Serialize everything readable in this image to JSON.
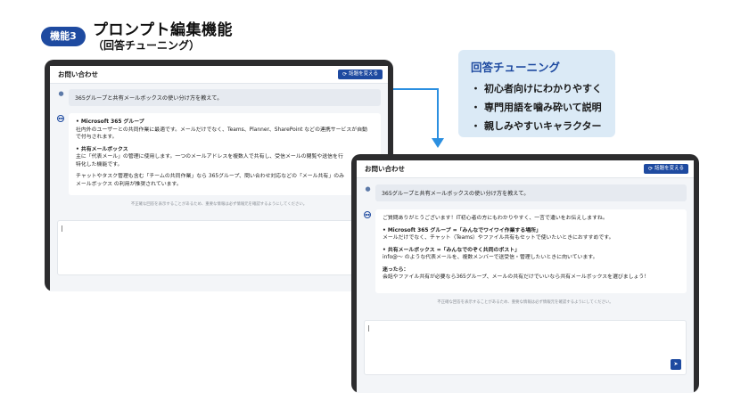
{
  "header": {
    "badge": "機能3",
    "title": "プロンプト編集機能",
    "subtitle": "（回答チューニング）"
  },
  "callout": {
    "title": "回答チューニング",
    "items": [
      "初心者向けにわかりやすく",
      "専門用語を噛み砕いて説明",
      "親しみやすいキャラクター"
    ],
    "bullet": "・"
  },
  "colors": {
    "accent": "#1e4aa0",
    "arrow": "#2b8fe0",
    "callout_bg": "#dbeaf6"
  },
  "icons": {
    "user": "user-icon",
    "bot": "bot-icon",
    "refresh": "refresh-icon",
    "send": "send-icon"
  },
  "left_screen": {
    "app_title": "お問い合わせ",
    "topic_button": "話題を変える",
    "user_message": "365グループと共有メールボックスの使い分け方を教えて。",
    "bot": {
      "h1": "• Microsoft 365 グループ",
      "p1a": "社内外のユーザーとの共同作業に最適です。メールだけでなく、Teams、Planner、SharePoint などの連携サービスが自動",
      "p1b": "で付与されます。",
      "h2": "• 共有メールボックス",
      "p2a": "主に「代表メール」の管理に使用します。一つのメールアドレスを複数人で共有し、受信メールの閲覧や送信を行",
      "p2b": "特化した機能です。",
      "p3a": "チャットやタスク管理も含む「チームの共同作業」なら 365グループ、問い合わせ対応などの「メール共有」のみ",
      "p3b": "メールボックス の利用が推奨されています。"
    },
    "disclaimer": "不正確な回答を表示することがあるため、重要な情報は必ず情報元を確認するようにしてください。"
  },
  "right_screen": {
    "app_title": "お問い合わせ",
    "topic_button": "話題を変える",
    "user_message": "365グループと共有メールボックスの使い分け方を教えて。",
    "bot": {
      "intro": "ご質問ありがとうございます！IT初心者の方にもわかりやすく、一言で違いをお伝えしますね。",
      "h1": "• Microsoft 365 グループ =「みんなでワイワイ作業する場所」",
      "p1": "メールだけでなく、チャット（Teams）やファイル共有もセットで使いたいときにおすすめです。",
      "h2": "• 共有メールボックス =「みんなでのぞく共同のポスト」",
      "p2": "info@～ のような代表メールを、複数メンバーで送受信・管理したいときに向いています。",
      "h3": "迷ったら：",
      "p3": "会話やファイル共有が必要なら365グループ、メールの共有だけでいいなら共有メールボックスを選びましょう！"
    },
    "disclaimer": "不正確な回答を表示することがあるため、重要な情報は必ず情報元を確認するようにしてください。"
  }
}
